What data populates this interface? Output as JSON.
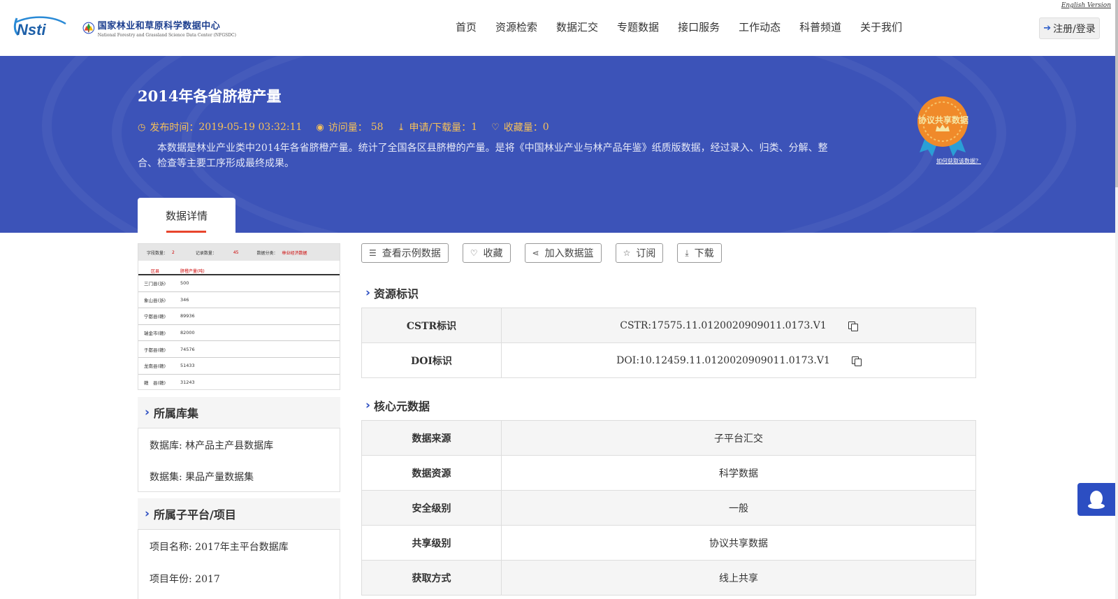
{
  "header": {
    "logo_nsti": "Nsti",
    "logo_cn": "国家林业和草原科学数据中心",
    "logo_en": "National Forestry and Grassland Science Data Center (NFGSDC)",
    "english_link": "English Version",
    "nav": [
      "首页",
      "资源检索",
      "数据汇交",
      "专题数据",
      "接口服务",
      "工作动态",
      "科普频道",
      "关于我们"
    ],
    "login_label": "注册/登录"
  },
  "dataset": {
    "title": "2014年各省脐橙产量",
    "publish_label": "发布时间：",
    "publish_time": "2019-05-19 03:32:11",
    "visits_label": "访问量：",
    "visits": "58",
    "downloads_label": "申请/下载量：",
    "downloads": "1",
    "favorites_label": "收藏量：",
    "favorites": "0",
    "description": "本数据是林业产业类中2014年各省脐橙产量。统计了全国各区县脐橙的产量。是将《中国林业产业与林产品年鉴》纸质版数据，经过录入、归类、分解、整合、检查等主要工序形成最终成果。",
    "badge_label": "协议共享数据",
    "badge_link": "如何获取该数据？"
  },
  "tabs": {
    "active": "数据详情"
  },
  "preview": {
    "header": {
      "field_count_label": "字段数量：",
      "field_count": "2",
      "record_count_label": "记录数量：",
      "record_count": "45",
      "category_label": "数据分类：",
      "category": "林业经济数据"
    },
    "columns": [
      "区县",
      "脐橙产量(吨)"
    ],
    "rows": [
      [
        "三门县(浙)",
        "500"
      ],
      [
        "象山县(浙)",
        "346"
      ],
      [
        "宁都县(赣)",
        "89936"
      ],
      [
        "瑞金市(赣)",
        "82000"
      ],
      [
        "于都县(赣)",
        "74576"
      ],
      [
        "龙南县(赣)",
        "51433"
      ],
      [
        "赣　县(赣)",
        "31243"
      ]
    ]
  },
  "library": {
    "title": "所属库集",
    "database": "数据库: 林产品主产县数据库",
    "dataset": "数据集: 果品产量数据集"
  },
  "platform": {
    "title": "所属子平台/项目",
    "project_name": "项目名称: 2017年主平台数据库",
    "project_year": "项目年份: 2017"
  },
  "actions": {
    "sample": "查看示例数据",
    "favorite": "收藏",
    "basket": "加入数据篮",
    "subscribe": "订阅",
    "download": "下载"
  },
  "identifiers": {
    "title": "资源标识",
    "rows": [
      {
        "key": "CSTR标识",
        "value": "CSTR:17575.11.0120020909011.0173.V1"
      },
      {
        "key": "DOI标识",
        "value": "DOI:10.12459.11.0120020909011.0173.V1"
      }
    ]
  },
  "core_meta": {
    "title": "核心元数据",
    "rows": [
      {
        "key": "数据来源",
        "value": "子平台汇交"
      },
      {
        "key": "数据资源",
        "value": "科学数据"
      },
      {
        "key": "安全级别",
        "value": "一般"
      },
      {
        "key": "共享级别",
        "value": "协议共享数据"
      },
      {
        "key": "获取方式",
        "value": "线上共享"
      }
    ]
  },
  "colors": {
    "banner": "#3c53b8",
    "accent_blue": "#2c4ec2",
    "meta_gold": "#f5c05a",
    "tab_underline": "#e8452c"
  }
}
